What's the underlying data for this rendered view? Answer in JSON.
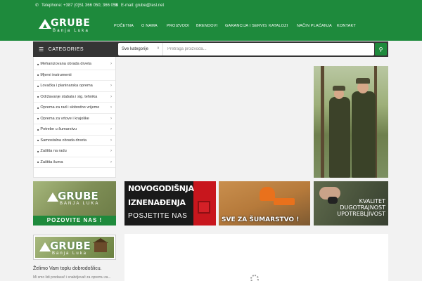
{
  "contact": {
    "phone": "Telephone: +387 (0)51 366 050; 366 051",
    "email": "E-mail: grube@tesl.net"
  },
  "brand": {
    "name": "GRUBE",
    "city": "Banja Luka"
  },
  "nav": [
    {
      "label": "POČETNA"
    },
    {
      "label": "O NAMA"
    },
    {
      "label": "PROIZVODI"
    },
    {
      "label": "BRENDOVI"
    },
    {
      "label": "GARANCIJA I SERVIS"
    },
    {
      "label": "KATALOZI"
    },
    {
      "label": "NAČIN PLAĆANJA"
    },
    {
      "label": "KONTAKT"
    }
  ],
  "categories_label": "CATEGORIES",
  "search": {
    "category": "Sve kategorije",
    "placeholder": "Pretraga proizvoda..."
  },
  "categories": [
    {
      "label": "Mehanizovana obrada drveta"
    },
    {
      "label": "Mjerni instrumenti"
    },
    {
      "label": "Lovačka i planinarska oprema"
    },
    {
      "label": "Održavanje stabala i sig. tehnika"
    },
    {
      "label": "Oprema za rad i slobodno vrijeme"
    },
    {
      "label": "Oprema za vrtove i krajolike"
    },
    {
      "label": "Potrebe u šumarstvu"
    },
    {
      "label": "Samostalna obrada drveta"
    },
    {
      "label": "Zaštita na radu"
    },
    {
      "label": "Zaštita šuma"
    }
  ],
  "banners": {
    "b1": {
      "brand": "GRUBE",
      "city": "BANJA LUKA",
      "cta": "POZOVITE NAS !"
    },
    "b2": {
      "line1": "NOVOGODIŠNJA",
      "line2": "IZNENAĐENJA",
      "line3": "POSJETITE NAS"
    },
    "b3": {
      "text": "SVE ZA ŠUMARSTVO !"
    },
    "b4": {
      "line1": "KVALITET",
      "line2": "DUGOTRAJNOST",
      "line3": "UPOTREBLJIVOST"
    }
  },
  "sidebar_logo": {
    "brand": "GRUBE",
    "city": "Banja Luka"
  },
  "welcome": "Želimo Vam toplu dobrodošlicu.",
  "small_text": "Mi smo lidi prodavač i snabdjevač za opremu za..."
}
